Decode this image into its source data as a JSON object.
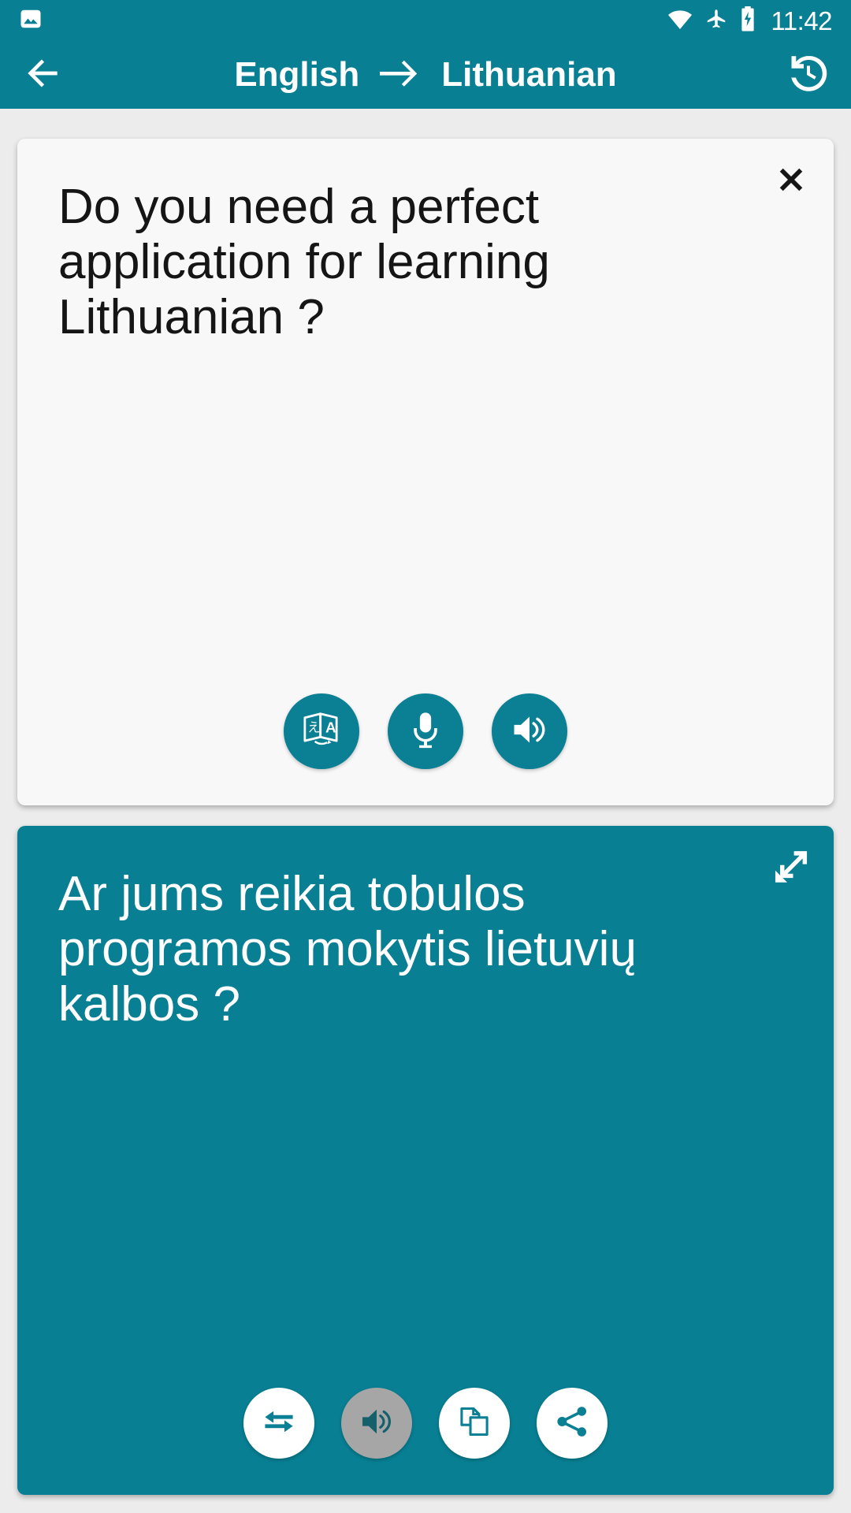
{
  "status_bar": {
    "time": "11:42",
    "icons": [
      "image-notification-icon",
      "wifi-icon",
      "airplane-mode-icon",
      "battery-charging-icon"
    ]
  },
  "app_bar": {
    "back_icon": "back-arrow-icon",
    "source_language": "English",
    "arrow": "right-arrow-icon",
    "target_language": "Lithuanian",
    "history_icon": "history-icon"
  },
  "source_card": {
    "text": "Do you need a perfect application for learning Lithuanian ?",
    "close_icon": "close-icon",
    "actions": [
      {
        "name": "translate-dictionary-button",
        "icon": "translate-icon"
      },
      {
        "name": "voice-input-button",
        "icon": "microphone-icon"
      },
      {
        "name": "speak-source-button",
        "icon": "speaker-icon"
      }
    ]
  },
  "target_card": {
    "text": "Ar jums reikia tobulos programos mokytis lietuvių kalbos ?",
    "expand_icon": "expand-icon",
    "actions": [
      {
        "name": "swap-languages-button",
        "icon": "swap-arrows-icon",
        "state": "enabled"
      },
      {
        "name": "speak-translation-button",
        "icon": "speaker-icon",
        "state": "disabled"
      },
      {
        "name": "copy-button",
        "icon": "copy-icon",
        "state": "enabled"
      },
      {
        "name": "share-button",
        "icon": "share-icon",
        "state": "enabled"
      }
    ]
  },
  "colors": {
    "primary_teal": "#087f93",
    "card_teal": "#087f93",
    "source_card_bg": "#f8f8f8",
    "page_bg": "#ececec",
    "disabled_gray": "#a6a6a6",
    "icon_teal": "#0b7f93"
  }
}
